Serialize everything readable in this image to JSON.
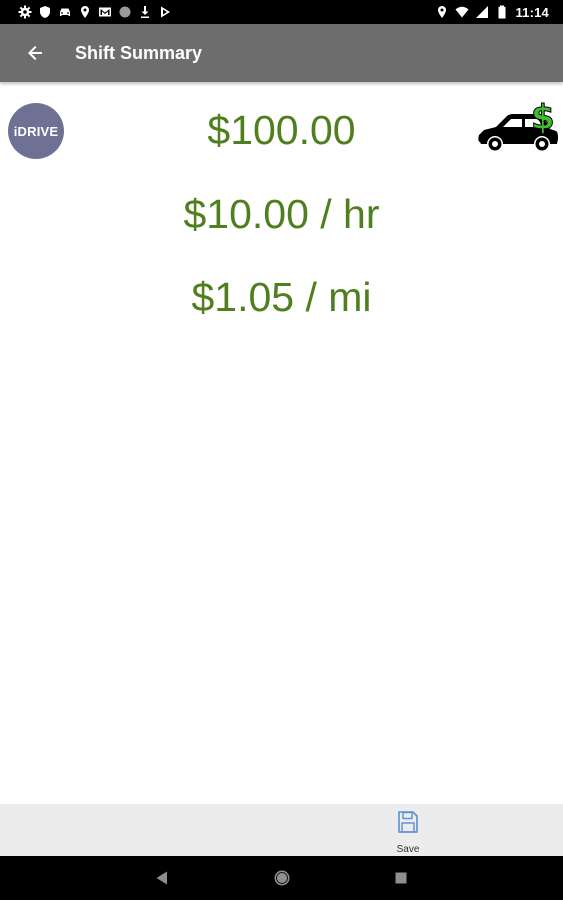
{
  "status_bar": {
    "time": "11:14",
    "left_icons": [
      "settings-icon",
      "shield-icon",
      "car-icon",
      "location-icon",
      "gmail-icon",
      "circle-icon",
      "download-icon",
      "play-store-icon"
    ],
    "right_icons": [
      "location-icon",
      "wifi-icon",
      "signal-icon",
      "battery-icon"
    ]
  },
  "app_bar": {
    "title": "Shift Summary",
    "background": "#6d6d6d"
  },
  "logo": {
    "text": "iDRIVE",
    "color": "#6f7194"
  },
  "summary": {
    "total": "$100.00",
    "per_hour": "$10.00 / hr",
    "per_mile": "$1.05 / mi",
    "color": "#4f7f1e"
  },
  "bottom_bar": {
    "save_label": "Save",
    "save_icon": "floppy-disk-icon",
    "icon_color": "#5b8fd6"
  },
  "nav_bar": {
    "icons": [
      "nav-back-icon",
      "nav-home-icon",
      "nav-recents-icon"
    ]
  }
}
